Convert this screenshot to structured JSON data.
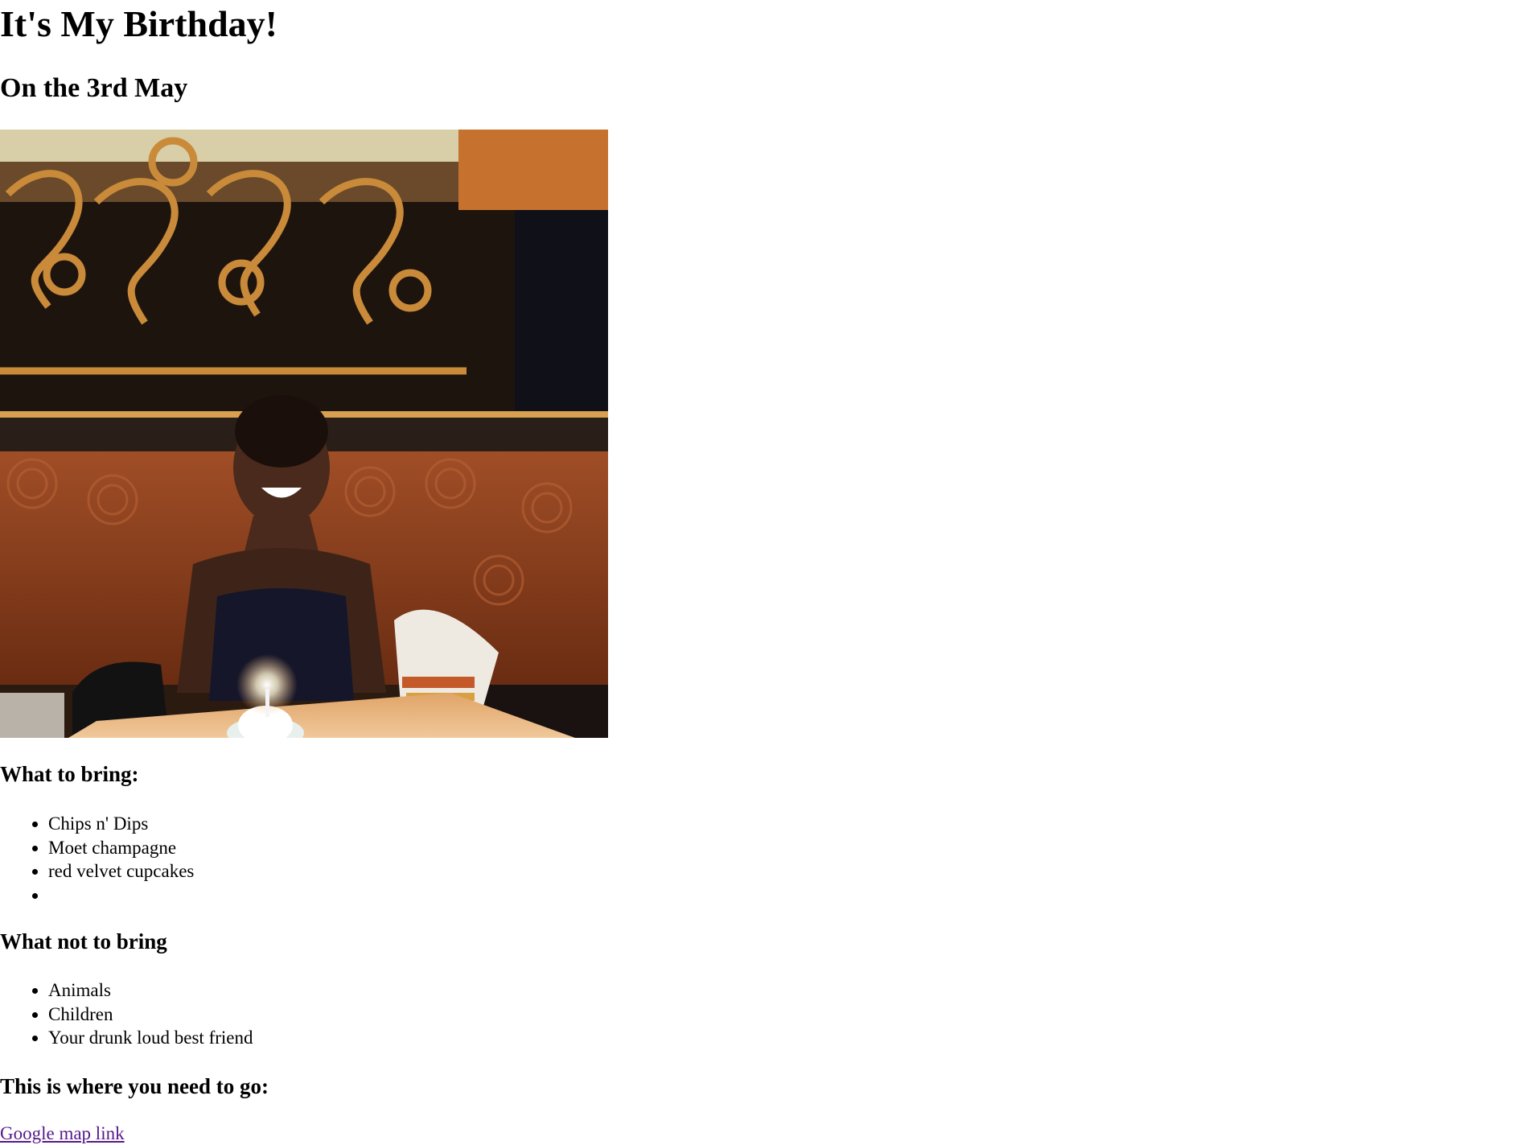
{
  "header": {
    "title": "It's My Birthday!",
    "subtitle": "On the 3rd May"
  },
  "photo": {
    "description_icon": "birthday-photo",
    "colors": {
      "booth": "#8a3d1c",
      "table": "#e8b37a",
      "dark": "#1a1410"
    }
  },
  "bring": {
    "heading": "What to bring:",
    "items": [
      "Chips n' Dips",
      "Moet champagne",
      "red velvet cupcakes",
      ""
    ]
  },
  "not_bring": {
    "heading": "What not to bring",
    "items": [
      "Animals",
      "Children",
      "Your drunk loud best friend"
    ]
  },
  "location": {
    "heading": "This is where you need to go:",
    "link_text": "Google map link",
    "link_color": "#551a8b"
  }
}
